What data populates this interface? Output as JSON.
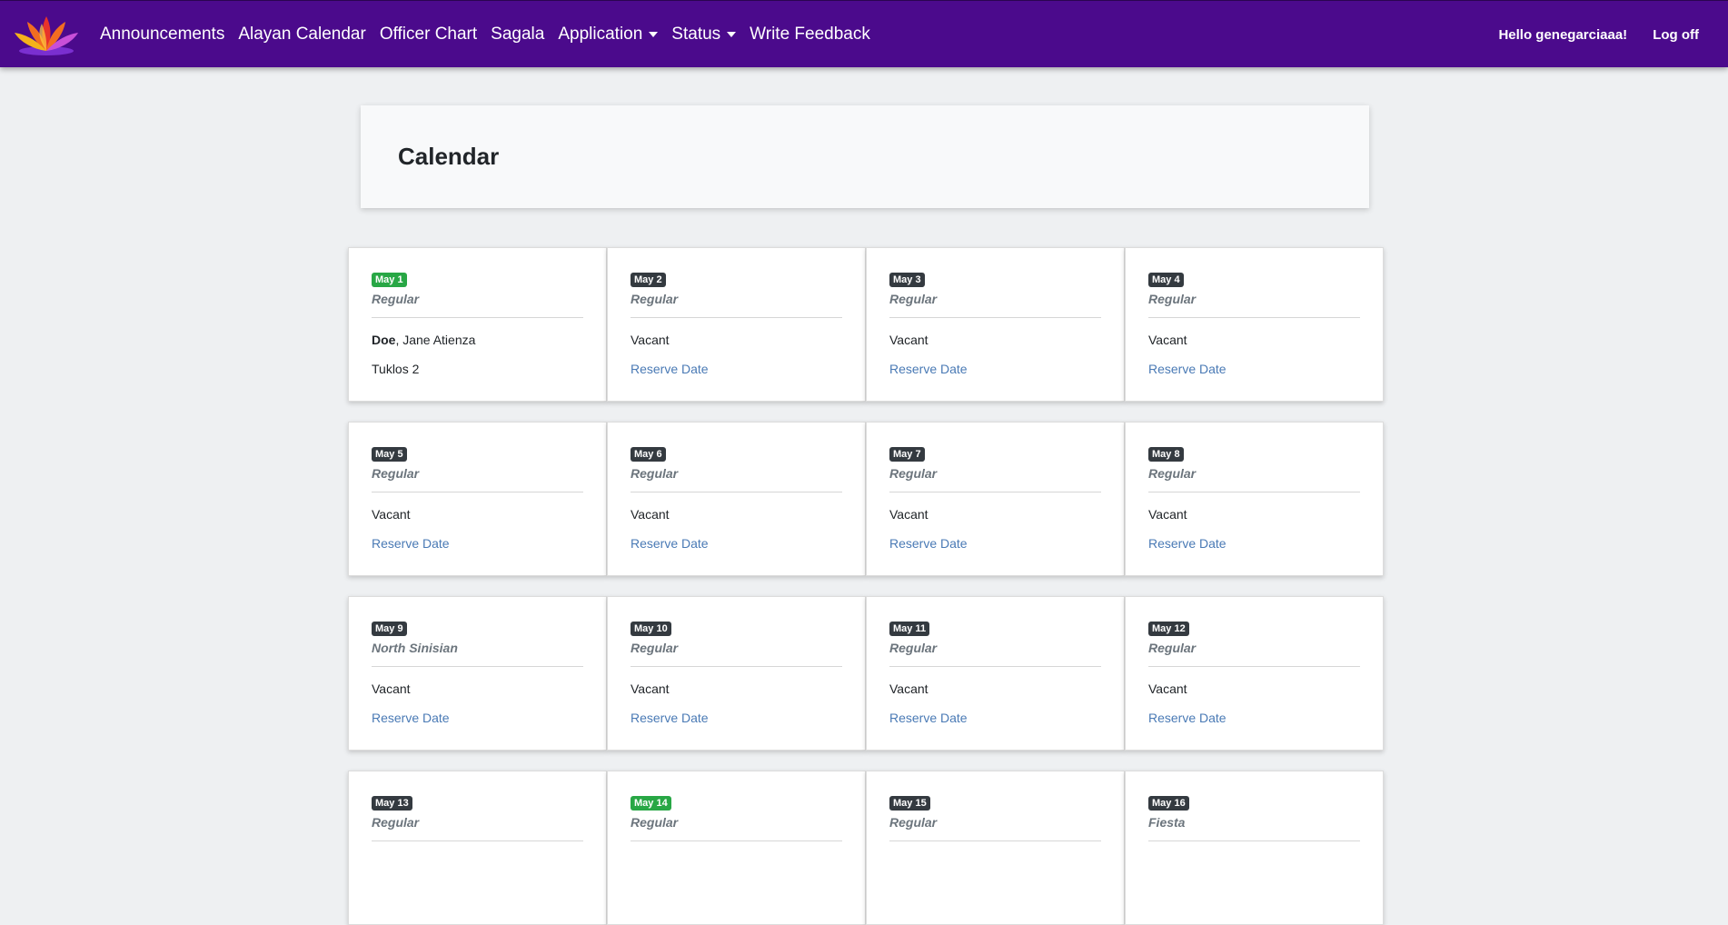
{
  "nav": {
    "logo_icon": "lotus-logo-icon",
    "links": [
      "Announcements",
      "Alayan Calendar",
      "Officer Chart",
      "Sagala"
    ],
    "application_label": "Application",
    "status_label": "Status",
    "feedback_label": "Write Feedback",
    "greeting": "Hello genegarciaaa!",
    "logoff_label": "Log off"
  },
  "page": {
    "title": "Calendar"
  },
  "colors": {
    "navbar": "#4b0a8c",
    "badge_default": "#343a40",
    "badge_highlight": "#28a745",
    "link": "#4a7ab5"
  },
  "days": [
    {
      "date": "May 1",
      "highlight": true,
      "type": "Regular",
      "surname": "Doe",
      "given": ", Jane Atienza",
      "detail": "Tuklos 2",
      "status": "",
      "action": ""
    },
    {
      "date": "May 2",
      "highlight": false,
      "type": "Regular",
      "status": "Vacant",
      "action": "Reserve Date"
    },
    {
      "date": "May 3",
      "highlight": false,
      "type": "Regular",
      "status": "Vacant",
      "action": "Reserve Date"
    },
    {
      "date": "May 4",
      "highlight": false,
      "type": "Regular",
      "status": "Vacant",
      "action": "Reserve Date"
    },
    {
      "date": "May 5",
      "highlight": false,
      "type": "Regular",
      "status": "Vacant",
      "action": "Reserve Date"
    },
    {
      "date": "May 6",
      "highlight": false,
      "type": "Regular",
      "status": "Vacant",
      "action": "Reserve Date"
    },
    {
      "date": "May 7",
      "highlight": false,
      "type": "Regular",
      "status": "Vacant",
      "action": "Reserve Date"
    },
    {
      "date": "May 8",
      "highlight": false,
      "type": "Regular",
      "status": "Vacant",
      "action": "Reserve Date"
    },
    {
      "date": "May 9",
      "highlight": false,
      "type": "North Sinisian",
      "status": "Vacant",
      "action": "Reserve Date"
    },
    {
      "date": "May 10",
      "highlight": false,
      "type": "Regular",
      "status": "Vacant",
      "action": "Reserve Date"
    },
    {
      "date": "May 11",
      "highlight": false,
      "type": "Regular",
      "status": "Vacant",
      "action": "Reserve Date"
    },
    {
      "date": "May 12",
      "highlight": false,
      "type": "Regular",
      "status": "Vacant",
      "action": "Reserve Date"
    },
    {
      "date": "May 13",
      "highlight": false,
      "type": "Regular",
      "status": "",
      "action": ""
    },
    {
      "date": "May 14",
      "highlight": true,
      "type": "Regular",
      "status": "",
      "action": ""
    },
    {
      "date": "May 15",
      "highlight": false,
      "type": "Regular",
      "status": "",
      "action": ""
    },
    {
      "date": "May 16",
      "highlight": false,
      "type": "Fiesta",
      "status": "",
      "action": ""
    }
  ]
}
